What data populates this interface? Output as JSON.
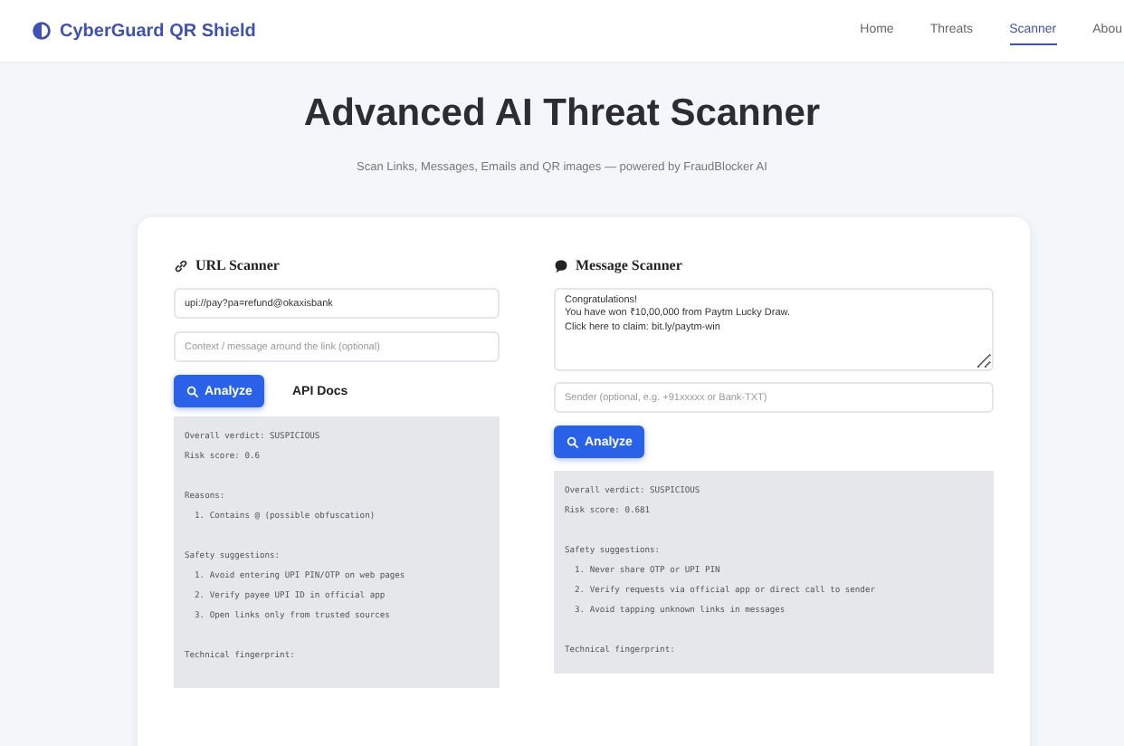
{
  "navbar": {
    "brand": "CyberGuard QR Shield",
    "links": [
      {
        "label": "Home",
        "selected": false
      },
      {
        "label": "Threats",
        "selected": false
      },
      {
        "label": "Scanner",
        "selected": true
      },
      {
        "label": "Abou",
        "selected": false
      }
    ]
  },
  "hero": {
    "title": "Advanced AI Threat Scanner",
    "subtitle": "Scan Links, Messages, Emails and QR images — powered by FraudBlocker AI"
  },
  "url_scanner": {
    "heading": "URL Scanner",
    "url_value": "upi://pay?pa=refund@okaxisbank",
    "context_placeholder": "Context / message around the link (optional)",
    "analyze_button": "Analyze",
    "docs_button": "API Docs",
    "output_blocks": [
      [
        "Overall verdict: SUSPICIOUS",
        "Risk score: 0.6"
      ],
      [
        "Reasons:",
        "  1. Contains @ (possible obfuscation)"
      ],
      [
        "Safety suggestions:",
        "  1. Avoid entering UPI PIN/OTP on web pages",
        "  2. Verify payee UPI ID in official app",
        "  3. Open links only from trusted sources"
      ],
      [
        "Technical fingerprint:"
      ]
    ]
  },
  "message_scanner": {
    "heading": "Message Scanner",
    "message_value": "Congratulations!\nYou have won ₹10,00,000 from Paytm Lucky Draw.\nClick here to claim: bit.ly/paytm-win",
    "sender_placeholder": "Sender (optional, e.g. +91xxxxx or Bank-TXT)",
    "analyze_button": "Analyze",
    "output_blocks": [
      [
        "Overall verdict: SUSPICIOUS",
        "Risk score: 0.681"
      ],
      [
        "Safety suggestions:",
        "  1. Never share OTP or UPI PIN",
        "  2. Verify requests via official app or direct call to sender",
        "  3. Avoid tapping unknown links in messages"
      ],
      [
        "Technical fingerprint:"
      ]
    ]
  }
}
